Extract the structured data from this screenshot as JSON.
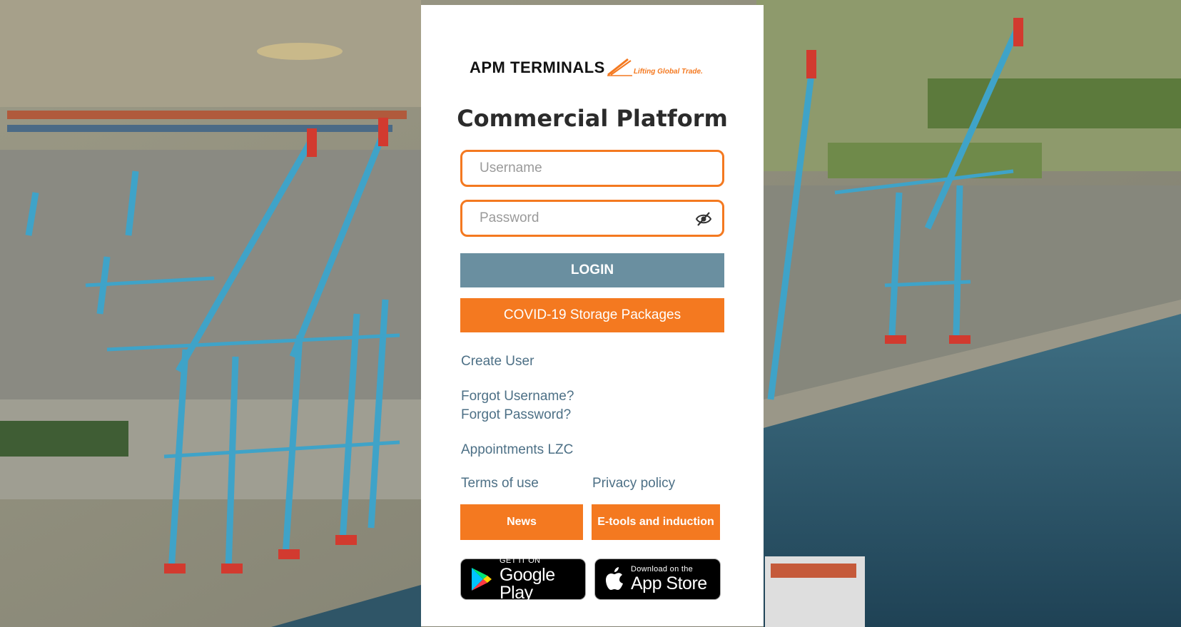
{
  "brand": {
    "name": "APM TERMINALS",
    "tagline": "Lifting Global Trade.",
    "orange": "#f47920",
    "steel_blue": "#6a8fa0"
  },
  "page_title": "Commercial Platform",
  "login_form": {
    "username_placeholder": "Username",
    "password_placeholder": "Password",
    "toggle_visibility_icon": "eye-slash-icon",
    "login_label": "LOGIN"
  },
  "covid_button_label": "COVID-19 Storage Packages",
  "links": {
    "create_user": "Create User",
    "forgot_username": "Forgot Username?",
    "forgot_password": "Forgot Password?",
    "appointments": "Appointments LZC",
    "terms": "Terms of use",
    "privacy": "Privacy policy"
  },
  "buttons": {
    "news": "News",
    "etools": "E-tools and induction"
  },
  "stores": {
    "google_small": "GET IT ON",
    "google_big": "Google Play",
    "apple_small": "Download on the",
    "apple_big": "App Store"
  }
}
